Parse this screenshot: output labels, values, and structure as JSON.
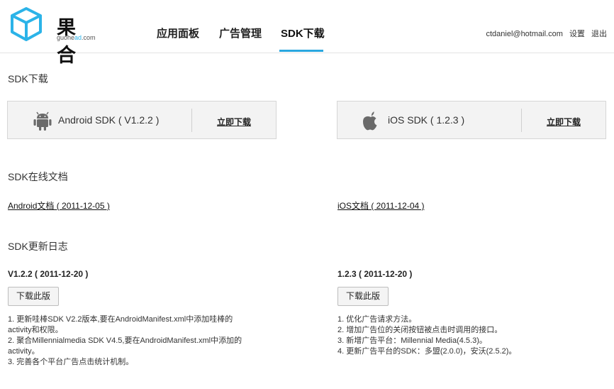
{
  "brand": {
    "name": "果合",
    "domain_prefix": "guohe",
    "domain_highlight": "ad",
    "domain_suffix": ".com",
    "color": "#2bb3e8"
  },
  "nav": {
    "items": [
      {
        "label": "应用面板"
      },
      {
        "label": "广告管理"
      },
      {
        "label": "SDK下载"
      }
    ],
    "active_index": 2,
    "accent": "#2aa7df"
  },
  "user": {
    "email": "ctdaniel@hotmail.com",
    "settings": "设置",
    "logout": "退出"
  },
  "download": {
    "title": "SDK下载",
    "android": {
      "icon": "android-icon",
      "label": "Android SDK ( V1.2.2 )",
      "link": "立即下载"
    },
    "ios": {
      "icon": "apple-icon",
      "label": "iOS SDK ( 1.2.3 )",
      "link": "立即下载"
    }
  },
  "docs": {
    "title": "SDK在线文档",
    "android": "Android文档 ( 2011-12-05 )",
    "ios": "iOS文档 ( 2011-12-04 )"
  },
  "changelog": {
    "title": "SDK更新日志",
    "android": {
      "version": "V1.2.2 ( 2011-12-20 )",
      "button": "下载此版",
      "items": [
        "1. 更新哇棒SDK V2.2版本,要在AndroidManifest.xml中添加哇棒的",
        "activity和权限。",
        "2. 聚合Millennialmedia SDK V4.5,要在AndroidManifest.xml中添加的",
        "activity。",
        "3. 完善各个平台广告点击统计机制。"
      ]
    },
    "ios": {
      "version": "1.2.3 ( 2011-12-20 )",
      "button": "下载此版",
      "items": [
        "1. 优化广告请求方法。",
        "2. 增加广告位的关闭按钮被点击时调用的接口。",
        "3. 新增广告平台：Millennial Media(4.5.3)。",
        "4. 更新广告平台的SDK：多盟(2.0.0)，安沃(2.5.2)。"
      ]
    }
  }
}
